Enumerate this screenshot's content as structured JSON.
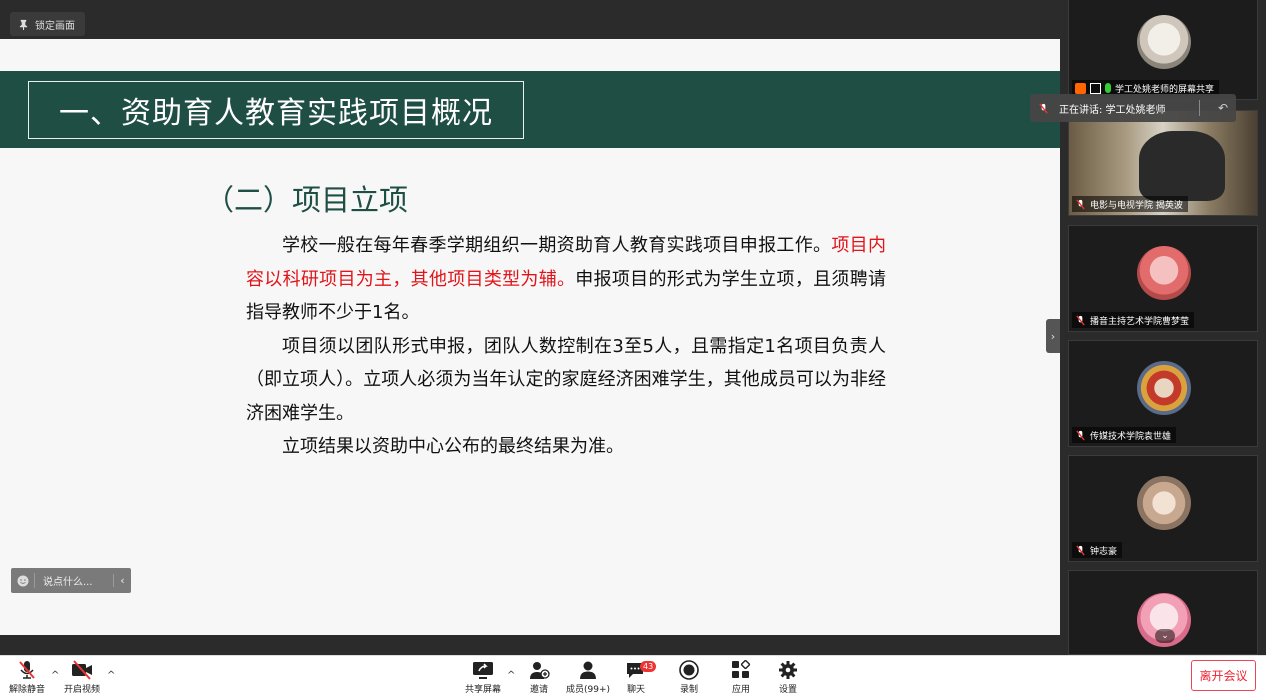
{
  "topbar": {
    "lock_label": "锁定画面"
  },
  "slide": {
    "title": "一、资助育人教育实践项目概况",
    "subtitle": "（二）项目立项",
    "p1_a": "学校一般在每年春季学期组织一期资助育人教育实践项目申报工作。",
    "p1_red": "项目内容以科研项目为主，其他项目类型为辅。",
    "p1_b": "申报项目的形式为学生立项，且须聘请指导教师不少于1名。",
    "p2": "项目须以团队形式申报，团队人数控制在3至5人，且需指定1名项目负责人（即立项人）。立项人必须为当年认定的家庭经济困难学生，其他成员可以为非经济困难学生。",
    "p3": "立项结果以资助中心公布的最终结果为准。"
  },
  "chat": {
    "placeholder": "说点什么..."
  },
  "speaker_tip": {
    "label": "正在讲话: 学工处姚老师"
  },
  "participants": [
    {
      "name": "学工处姚老师的屏幕共享"
    },
    {
      "name": "电影与电视学院 揭英波"
    },
    {
      "name": "播音主持艺术学院曹梦莹"
    },
    {
      "name": "传媒技术学院袁世雄"
    },
    {
      "name": "钟志豪"
    },
    {
      "name": ""
    }
  ],
  "toolbar": {
    "unmute": "解除静音",
    "video": "开启视频",
    "share": "共享屏幕",
    "invite": "邀请",
    "members": "成员(99+)",
    "chat": "聊天",
    "chat_badge": "43",
    "record": "录制",
    "apps": "应用",
    "settings": "设置",
    "leave": "离开会议"
  },
  "colors": {
    "slide_band": "#1f4e44",
    "highlight_red": "#e1141a",
    "leave_red": "#e23333"
  }
}
